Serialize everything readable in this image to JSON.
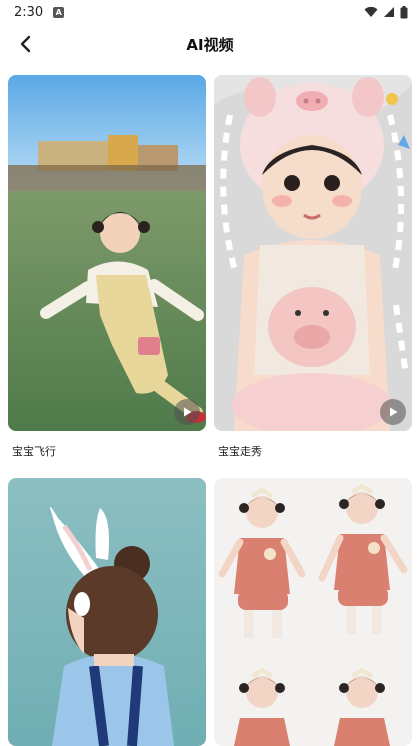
{
  "status_bar": {
    "time": "2:30",
    "notification_badge": "A"
  },
  "header": {
    "title": "AI视频"
  },
  "videos": [
    {
      "caption": "宝宝飞行",
      "scene": "toddler-running-on-grass"
    },
    {
      "caption": "宝宝走秀",
      "scene": "baby-with-pig-hat"
    },
    {
      "caption": "",
      "scene": "girl-with-bunny-ears"
    },
    {
      "caption": "",
      "scene": "toddler-pink-outfit-collage"
    }
  ],
  "colors": {
    "accent": "#111111",
    "play_badge": "#5a5a5a"
  }
}
